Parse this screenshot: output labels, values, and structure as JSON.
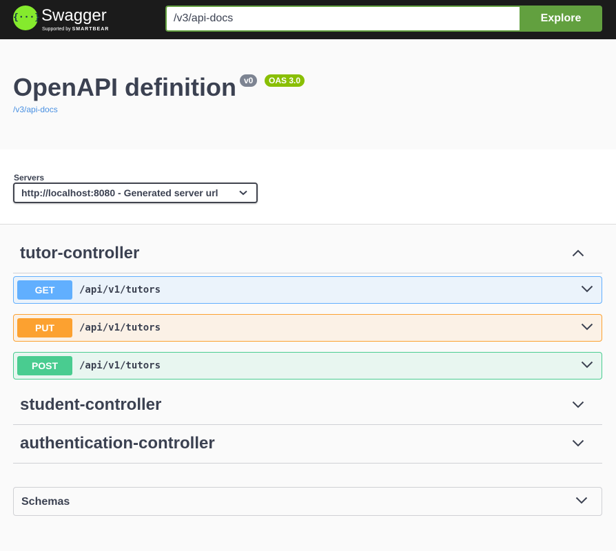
{
  "topbar": {
    "logo_glyph": "{···}",
    "brand_name": "Swagger",
    "brand_sub_prefix": "Supported by",
    "brand_sub_company": "SMARTBEAR",
    "url_value": "/v3/api-docs",
    "explore_label": "Explore",
    "accent_color": "#62a03f"
  },
  "info": {
    "title": "OpenAPI definition",
    "version_badge": "v0",
    "oas_badge": "OAS 3.0",
    "link_text": "/v3/api-docs"
  },
  "servers": {
    "label": "Servers",
    "selected": "http://localhost:8080 - Generated server url"
  },
  "tags": [
    {
      "name": "tutor-controller",
      "expanded": true,
      "icon": "chevron-up-icon",
      "operations": [
        {
          "method": "GET",
          "path": "/api/v1/tutors",
          "color": "#61affe"
        },
        {
          "method": "PUT",
          "path": "/api/v1/tutors",
          "color": "#fca130"
        },
        {
          "method": "POST",
          "path": "/api/v1/tutors",
          "color": "#49cc90"
        }
      ]
    },
    {
      "name": "student-controller",
      "expanded": false,
      "icon": "chevron-down-icon"
    },
    {
      "name": "authentication-controller",
      "expanded": false,
      "icon": "chevron-down-icon"
    }
  ],
  "schemas": {
    "label": "Schemas",
    "icon": "chevron-down-icon"
  }
}
